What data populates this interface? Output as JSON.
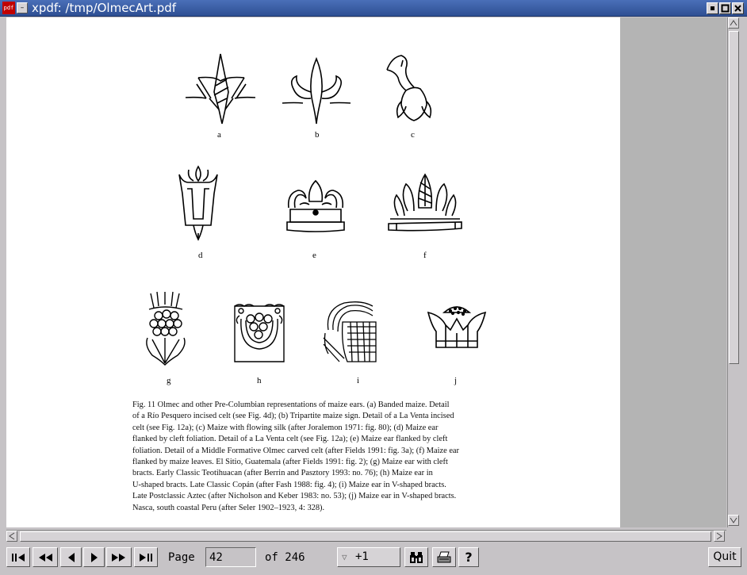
{
  "window": {
    "title": "xpdf: /tmp/OlmecArt.pdf",
    "app_icon_text": "pdf",
    "controls": [
      "minimize",
      "maximize",
      "close"
    ]
  },
  "document": {
    "figure_labels": [
      "a",
      "b",
      "c",
      "d",
      "e",
      "f",
      "g",
      "h",
      "i",
      "j"
    ],
    "caption_lines": [
      "Fig. 11  Olmec and other Pre-Columbian representations of maize ears. (a) Banded maize. Detail",
      "of a Río Pesquero incised celt (see Fig. 4d); (b) Tripartite maize sign. Detail of a La Venta incised",
      "celt (see Fig. 12a); (c) Maize with flowing silk (after Joralemon 1971: fig. 80); (d) Maize ear",
      "flanked by cleft foliation. Detail of a La Venta celt (see Fig. 12a); (e) Maize ear flanked by cleft",
      "foliation. Detail of a Middle Formative Olmec carved celt (after Fields 1991: fig. 3a); (f) Maize ear",
      "flanked by maize leaves. El Sitio, Guatemala (after Fields 1991: fig. 2); (g) Maize ear with cleft",
      "bracts. Early Classic Teotihuacan (after Berrin and Pasztory 1993: no. 76); (h) Maize ear in",
      "U-shaped bracts. Late Classic Copán (after Fash 1988: fig. 4); (i) Maize ear in V-shaped bracts.",
      "Late Postclassic Aztec (after Nicholson and Keber 1983: no. 53); (j) Maize ear in V-shaped bracts.",
      "Nasca, south coastal Peru (after Seler 1902–1923, 4: 328)."
    ]
  },
  "toolbar": {
    "page_label": "Page",
    "page_value": "42",
    "of_label": "of 246",
    "zoom_value": "+1",
    "quit_label": "Quit",
    "help_label": "?"
  }
}
